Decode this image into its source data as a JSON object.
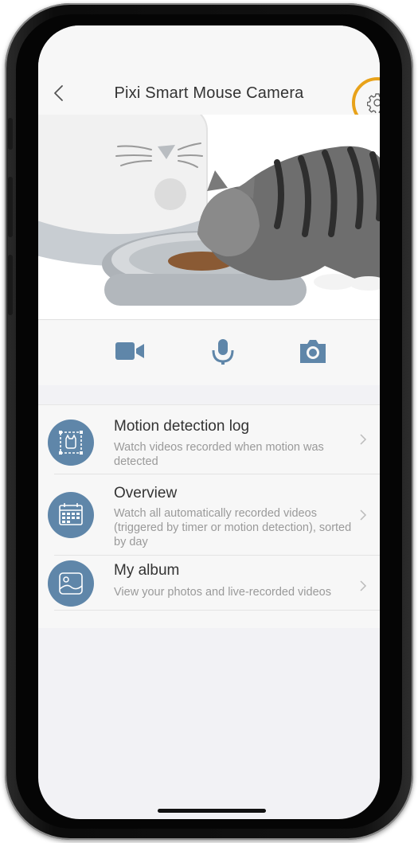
{
  "header": {
    "title": "Pixi Smart Mouse Camera",
    "back_icon": "chevron-left-icon",
    "settings_icon": "gear-icon",
    "highlight_color": "#e8a21a"
  },
  "controls": [
    {
      "icon": "video-camera-icon",
      "color": "#5f86a9"
    },
    {
      "icon": "microphone-icon",
      "color": "#5f86a9"
    },
    {
      "icon": "photo-camera-icon",
      "color": "#5f86a9"
    }
  ],
  "menu": {
    "items": [
      {
        "title": "Motion detection log",
        "subtitle": "Watch videos recorded when motion was detected",
        "icon": "motion-detection-icon"
      },
      {
        "title": "Overview",
        "subtitle": "Watch all automatically recorded videos (triggered by timer or motion detection), sorted by day",
        "icon": "calendar-icon"
      },
      {
        "title": "My album",
        "subtitle": "View your photos and live-recorded videos",
        "icon": "album-image-icon"
      }
    ],
    "accent_color": "#5f86a9"
  }
}
